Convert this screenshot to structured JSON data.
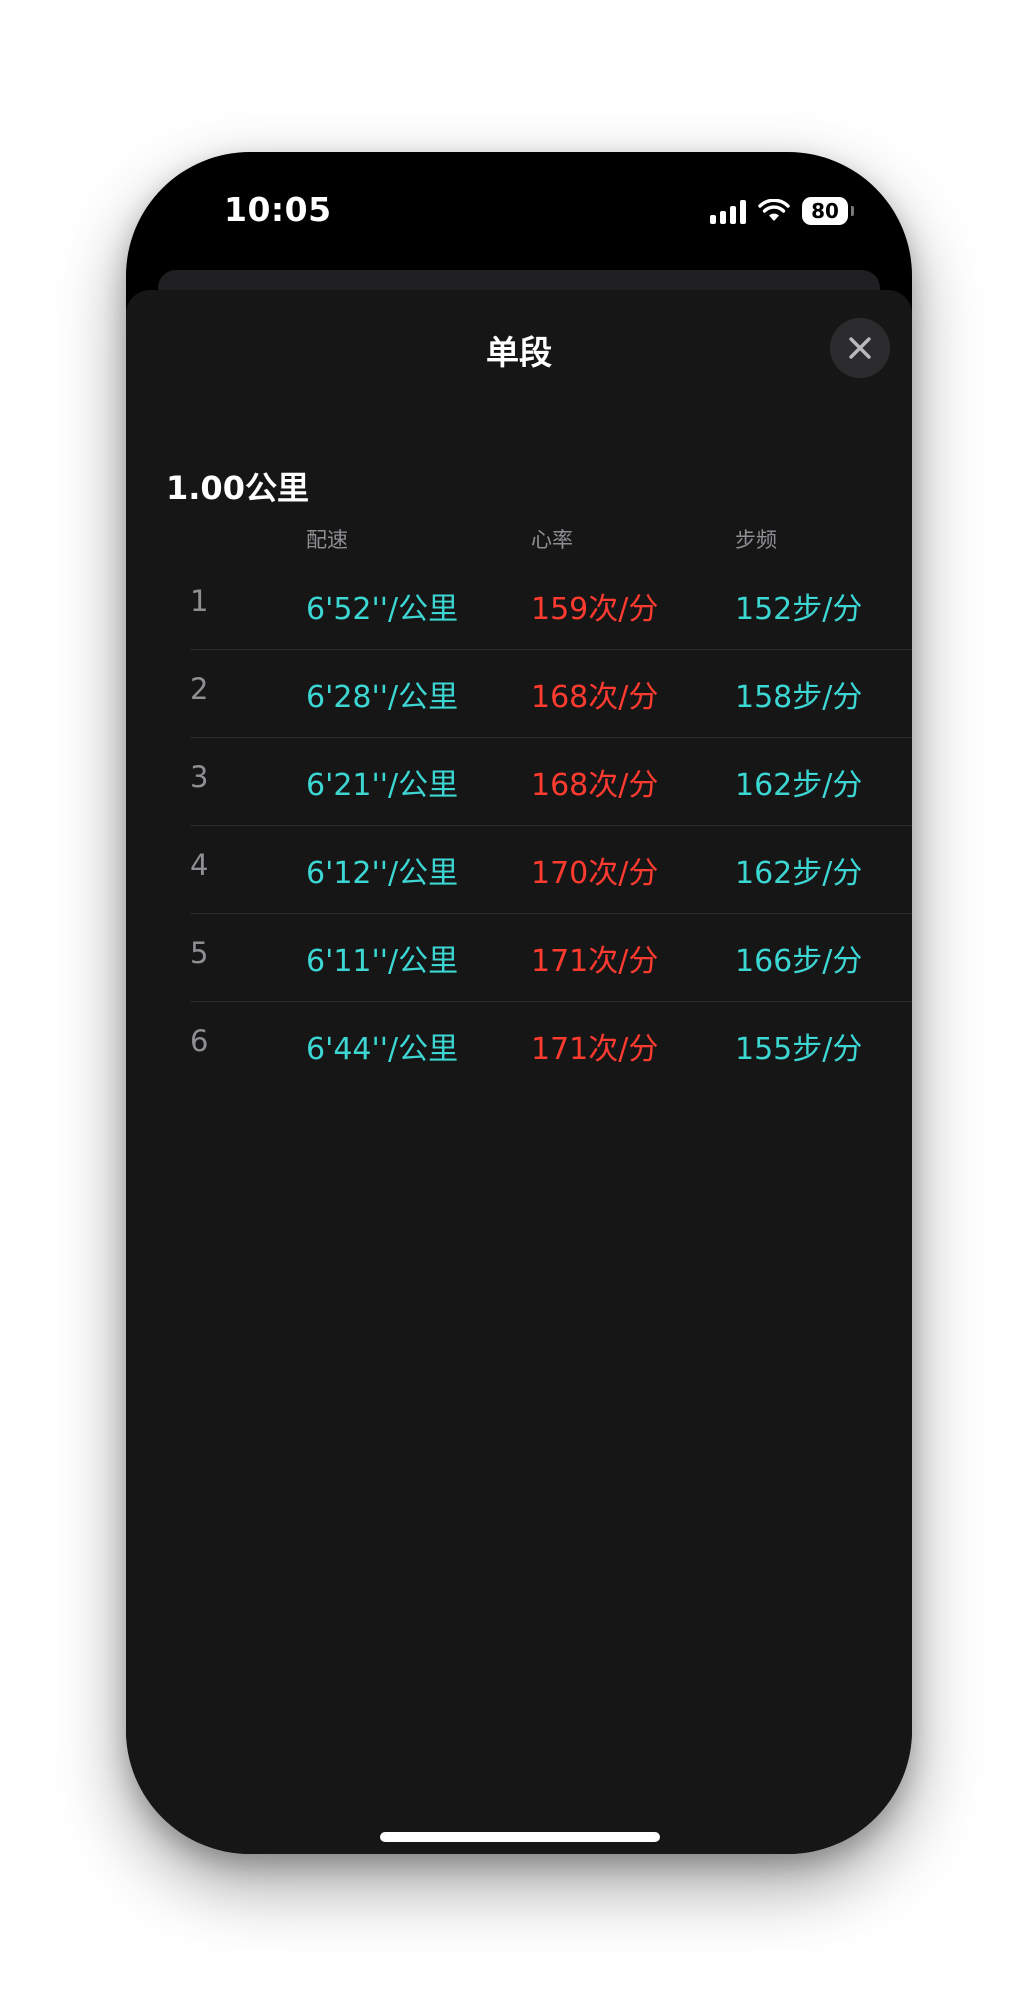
{
  "status_bar": {
    "time": "10:05",
    "battery": "80"
  },
  "sheet": {
    "title": "单段",
    "close_icon": "close-icon"
  },
  "section": {
    "title": "1.00公里"
  },
  "columns": {
    "pace": "配速",
    "heart_rate": "心率",
    "cadence": "步频"
  },
  "splits": [
    {
      "index": "1",
      "pace": "6'52''/公里",
      "heart_rate": "159次/分",
      "cadence": "152步/分"
    },
    {
      "index": "2",
      "pace": "6'28''/公里",
      "heart_rate": "168次/分",
      "cadence": "158步/分"
    },
    {
      "index": "3",
      "pace": "6'21''/公里",
      "heart_rate": "168次/分",
      "cadence": "162步/分"
    },
    {
      "index": "4",
      "pace": "6'12''/公里",
      "heart_rate": "170次/分",
      "cadence": "162步/分"
    },
    {
      "index": "5",
      "pace": "6'11''/公里",
      "heart_rate": "171次/分",
      "cadence": "166步/分"
    },
    {
      "index": "6",
      "pace": "6'44''/公里",
      "heart_rate": "171次/分",
      "cadence": "155步/分"
    }
  ],
  "colors": {
    "pace": "#3cd6d3",
    "heart_rate": "#ff3b30",
    "cadence": "#3cd6d3",
    "background": "#161616"
  }
}
